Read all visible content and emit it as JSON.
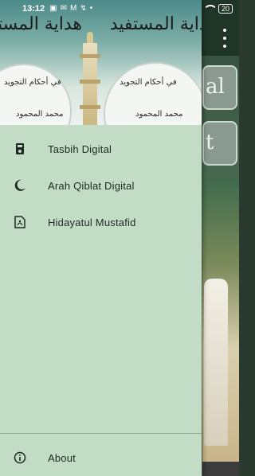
{
  "status_bar": {
    "time": "13:12",
    "battery": "20",
    "icons": [
      "sim-icon",
      "message-icon",
      "mail-icon",
      "download-icon",
      "dot-icon"
    ]
  },
  "drawer": {
    "header_title_arabic": "هداية المستفيد",
    "header_sub_arabic": "في أحكام التجويد",
    "header_author_arabic": "محمد المحمود",
    "items": [
      {
        "label": "Tasbih Digital",
        "icon": "counter-icon"
      },
      {
        "label": "Arah Qiblat Digital",
        "icon": "moon-icon"
      },
      {
        "label": "Hidayatul Mustafid",
        "icon": "pdf-icon"
      }
    ],
    "footer_item": {
      "label": "About",
      "icon": "info-icon"
    }
  },
  "background": {
    "card_1_text": "al",
    "card_2_text": "t"
  },
  "colors": {
    "drawer_bg": "#c2dcc6",
    "app_bar": "#1f3527",
    "text": "#1f2a22"
  }
}
